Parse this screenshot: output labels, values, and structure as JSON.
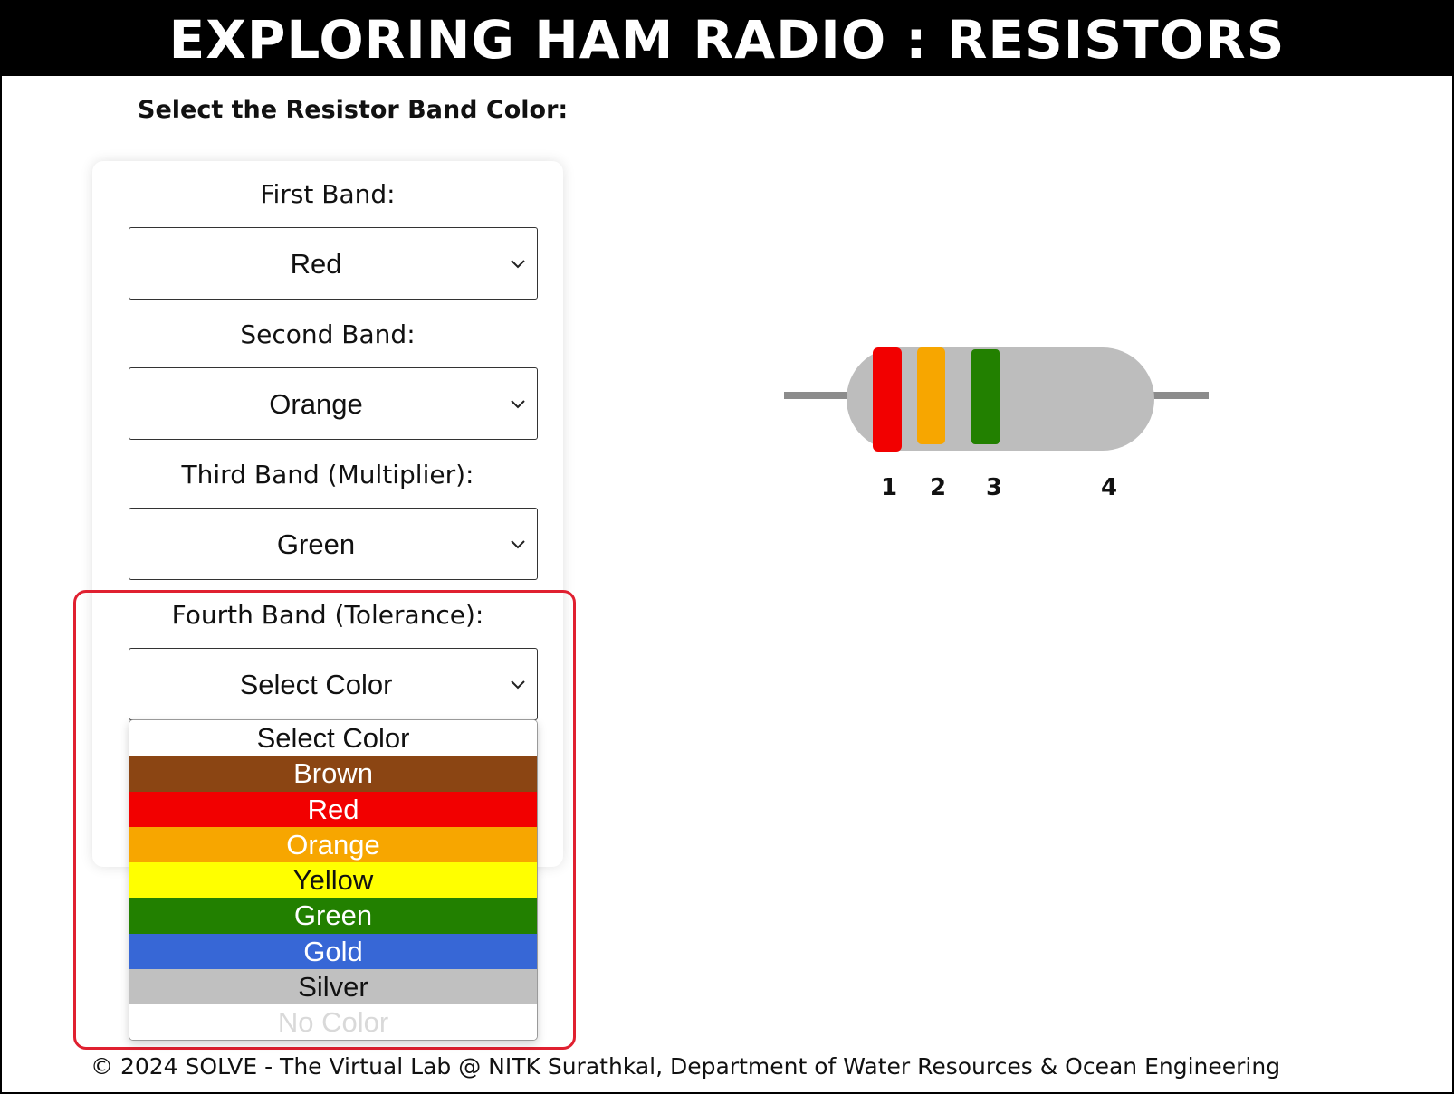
{
  "header": {
    "title": "EXPLORING HAM RADIO : RESISTORS"
  },
  "form": {
    "heading": "Select the Resistor Band Color:",
    "first_band": {
      "label": "First Band:",
      "value": "Red"
    },
    "second_band": {
      "label": "Second Band:",
      "value": "Orange"
    },
    "third_band": {
      "label": "Third Band (Multiplier):",
      "value": "Green"
    },
    "fourth_band": {
      "label": "Fourth Band (Tolerance):",
      "value": "Select Color"
    }
  },
  "dropdown": {
    "options": [
      {
        "label": "Select Color",
        "bg": "#ffffff",
        "fg": "#111111"
      },
      {
        "label": "Brown",
        "bg": "#8B4513",
        "fg": "#ffffff"
      },
      {
        "label": "Red",
        "bg": "#F20000",
        "fg": "#ffffff"
      },
      {
        "label": "Orange",
        "bg": "#F7A600",
        "fg": "#ffffff"
      },
      {
        "label": "Yellow",
        "bg": "#FFFF00",
        "fg": "#111111"
      },
      {
        "label": "Green",
        "bg": "#228000",
        "fg": "#ffffff"
      },
      {
        "label": "Gold",
        "bg": "#3767D6",
        "fg": "#ffffff"
      },
      {
        "label": "Silver",
        "bg": "#C0C0C0",
        "fg": "#111111"
      },
      {
        "label": "No Color",
        "bg": "#ffffff",
        "fg": "#d9d9d9"
      }
    ]
  },
  "resistor": {
    "band_colors": [
      "#F20000",
      "#F7A600",
      "#228000"
    ],
    "body_color": "#BDBDBD",
    "lead_color": "#8C8C8C",
    "band_numbers": [
      "1",
      "2",
      "3",
      "4"
    ]
  },
  "footer": {
    "text": "© 2024 SOLVE - The Virtual Lab @ NITK Surathkal, Department of Water Resources & Ocean Engineering"
  }
}
